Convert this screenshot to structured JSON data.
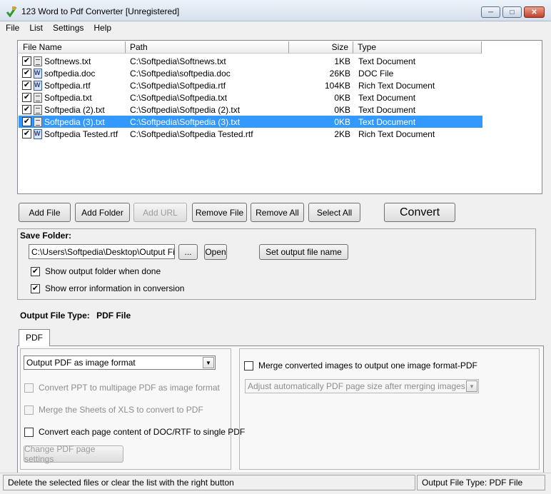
{
  "window": {
    "title": "123 Word to Pdf Converter [Unregistered]",
    "min_glyph": "─",
    "max_glyph": "□",
    "close_glyph": "✕"
  },
  "menu": [
    "File",
    "List",
    "Settings",
    "Help"
  ],
  "file_list": {
    "columns": [
      "File Name",
      "Path",
      "Size",
      "Type"
    ],
    "rows": [
      {
        "name": "Softnews.txt",
        "path": "C:\\Softpedia\\Softnews.txt",
        "size": "1KB",
        "type": "Text Document",
        "icon": "txt-file-icon",
        "checked": true,
        "selected": false
      },
      {
        "name": "softpedia.doc",
        "path": "C:\\Softpedia\\softpedia.doc",
        "size": "26KB",
        "type": "DOC File",
        "icon": "doc-file-icon",
        "checked": true,
        "selected": false
      },
      {
        "name": "Softpedia.rtf",
        "path": "C:\\Softpedia\\Softpedia.rtf",
        "size": "104KB",
        "type": "Rich Text Document",
        "icon": "doc-file-icon",
        "checked": true,
        "selected": false
      },
      {
        "name": "Softpedia.txt",
        "path": "C:\\Softpedia\\Softpedia.txt",
        "size": "0KB",
        "type": "Text Document",
        "icon": "txt-file-icon",
        "checked": true,
        "selected": false
      },
      {
        "name": "Softpedia (2).txt",
        "path": "C:\\Softpedia\\Softpedia (2).txt",
        "size": "0KB",
        "type": "Text Document",
        "icon": "txt-file-icon",
        "checked": true,
        "selected": false
      },
      {
        "name": "Softpedia (3).txt",
        "path": "C:\\Softpedia\\Softpedia (3).txt",
        "size": "0KB",
        "type": "Text Document",
        "icon": "txt-file-icon",
        "checked": true,
        "selected": true
      },
      {
        "name": "Softpedia Tested.rtf",
        "path": "C:\\Softpedia\\Softpedia Tested.rtf",
        "size": "2KB",
        "type": "Rich Text Document",
        "icon": "doc-file-icon",
        "checked": true,
        "selected": false
      }
    ]
  },
  "toolbar": {
    "add_file": "Add File",
    "add_folder": "Add Folder",
    "add_url": "Add URL",
    "remove_file": "Remove File",
    "remove_all": "Remove All",
    "select_all": "Select All",
    "convert": "Convert"
  },
  "save_folder": {
    "label": "Save Folder:",
    "path_value": "C:\\Users\\Softpedia\\Desktop\\Output Files",
    "browse_label": "...",
    "open_label": "Open",
    "set_name_label": "Set output file name",
    "show_output_folder": "Show output folder when done",
    "show_error_info": "Show error information in conversion"
  },
  "output_type": {
    "label": "Output File Type:",
    "value": "PDF File"
  },
  "pdf_tab": {
    "tab_label": "PDF",
    "format_select": "Output PDF as image format",
    "ppt_multipage": "Convert PPT to multipage PDF as image format",
    "merge_xls": "Merge the Sheets of XLS to convert to PDF",
    "each_page": "Convert each page content of DOC/RTF to single PDF",
    "page_settings": "Change PDF page settings",
    "merge_images": "Merge converted images to output one image format-PDF",
    "adjust_select": "Adjust automatically PDF page size after merging images to PDF"
  },
  "statusbar": {
    "hint": "Delete the selected files or clear the list with the right button",
    "output": "Output File Type:  PDF File"
  },
  "check_glyph": "✔",
  "arrow_glyph": "▼"
}
